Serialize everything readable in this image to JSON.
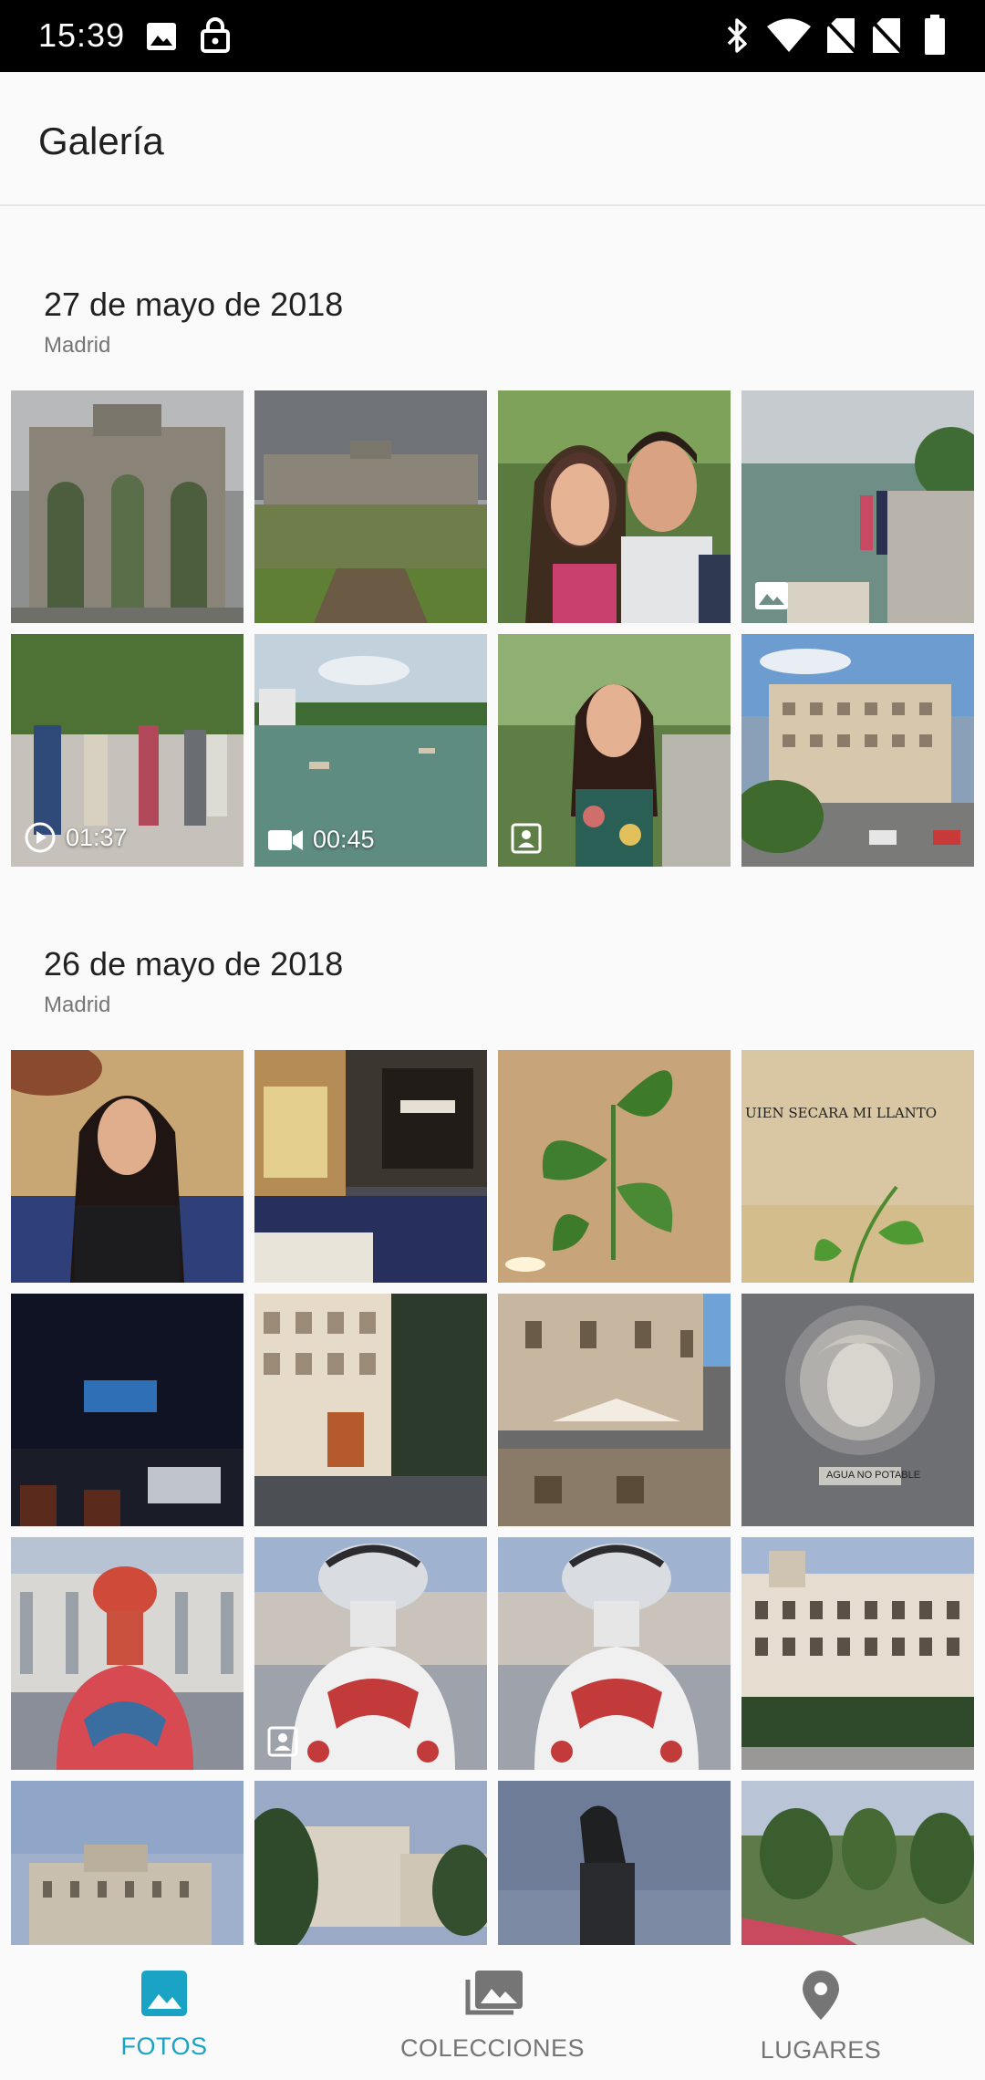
{
  "status_bar": {
    "time": "15:39"
  },
  "app_bar": {
    "title": "Galería"
  },
  "sections": [
    {
      "date": "27 de mayo de 2018",
      "place": "Madrid",
      "items": [
        {
          "kind": "photo",
          "desc": "puerta-de-alcala-close"
        },
        {
          "kind": "photo",
          "desc": "puerta-de-alcala-garden"
        },
        {
          "kind": "photo",
          "desc": "couple-selfie"
        },
        {
          "kind": "panorama",
          "desc": "retiro-lake-people",
          "badge_icon": "image-icon"
        },
        {
          "kind": "video",
          "desc": "crowd-walking",
          "duration": "01:37",
          "badge_icon": "play-circle-icon"
        },
        {
          "kind": "video",
          "desc": "retiro-lake-boats",
          "duration": "00:45",
          "badge_icon": "videocam-icon"
        },
        {
          "kind": "portrait",
          "desc": "woman-in-park",
          "badge_icon": "portrait-icon"
        },
        {
          "kind": "photo",
          "desc": "building-street"
        }
      ]
    },
    {
      "date": "26 de mayo de 2018",
      "place": "Madrid",
      "items": [
        {
          "kind": "photo",
          "desc": "woman-restaurant"
        },
        {
          "kind": "photo",
          "desc": "restaurant-interior"
        },
        {
          "kind": "photo",
          "desc": "plant-leaves"
        },
        {
          "kind": "photo",
          "desc": "wall-writing",
          "caption": "UIEN SECARA MI LLANTO"
        },
        {
          "kind": "photo",
          "desc": "dark-room"
        },
        {
          "kind": "photo",
          "desc": "street-corner-night"
        },
        {
          "kind": "photo",
          "desc": "terrace-dusk"
        },
        {
          "kind": "photo",
          "desc": "stone-relief",
          "caption": "AGUA NO POTABLE"
        },
        {
          "kind": "photo",
          "desc": "menina-statue-red"
        },
        {
          "kind": "portrait",
          "desc": "menina-statue-white",
          "badge_icon": "portrait-icon"
        },
        {
          "kind": "photo",
          "desc": "menina-statue-white-2"
        },
        {
          "kind": "photo",
          "desc": "building-facade-evening"
        },
        {
          "kind": "photo",
          "desc": "palace-dusk"
        },
        {
          "kind": "photo",
          "desc": "plaza-trees"
        },
        {
          "kind": "photo",
          "desc": "equestrian-statue"
        },
        {
          "kind": "photo",
          "desc": "flower-garden"
        }
      ]
    }
  ],
  "bottom_nav": {
    "items": [
      {
        "label": "FOTOS",
        "icon": "photo-icon",
        "active": true
      },
      {
        "label": "COLECCIONES",
        "icon": "collections-icon",
        "active": false
      },
      {
        "label": "LUGARES",
        "icon": "location-pin-icon",
        "active": false
      }
    ]
  },
  "colors": {
    "accent": "#1aa3c5",
    "inactive": "#757575",
    "status_bar": "#000000"
  }
}
